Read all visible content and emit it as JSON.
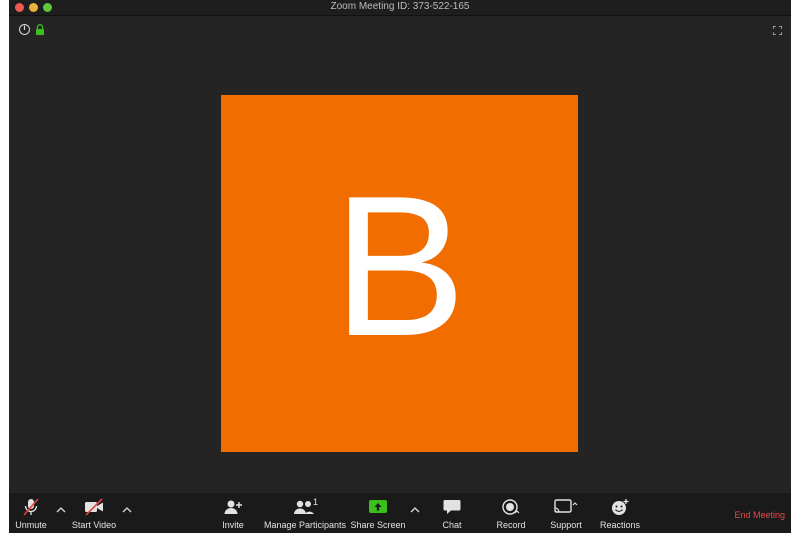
{
  "window": {
    "title": "Zoom Meeting ID: 373-522-165"
  },
  "participant": {
    "initial": "B",
    "tile_color": "#f26d00"
  },
  "toolbar": {
    "unmute_label": "Unmute",
    "start_video_label": "Start Video",
    "invite_label": "Invite",
    "manage_participants_label": "Manage Participants",
    "participant_count": "1",
    "share_screen_label": "Share Screen",
    "chat_label": "Chat",
    "record_label": "Record",
    "support_label": "Support",
    "reactions_label": "Reactions",
    "end_meeting_label": "End Meeting"
  },
  "colors": {
    "accent_green": "#3bbf1d",
    "end_red": "#e64949",
    "muted_red": "#e04040"
  }
}
